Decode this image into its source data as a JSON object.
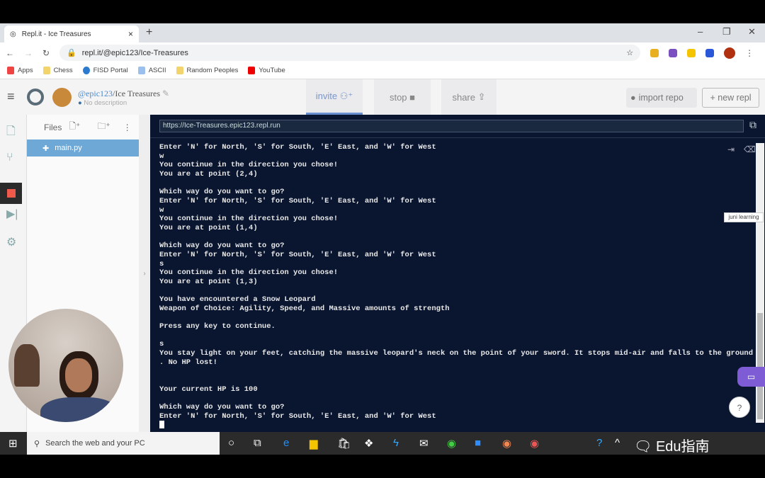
{
  "browser": {
    "tab_title": "Repl.it - Ice Treasures",
    "url": "repl.it/@epic123/Ice-Treasures",
    "bookmarks": [
      "Apps",
      "Chess",
      "FISD Portal",
      "ASCII",
      "Random Peoples",
      "YouTube"
    ]
  },
  "repl": {
    "user": "@epic123",
    "name": "/Ice Treasures",
    "description": "No description",
    "invite": "invite",
    "stop": "stop",
    "share": "share",
    "import_repo": "import repo",
    "new_repl": "+ new repl",
    "files_label": "Files",
    "file": "main.py",
    "run_url": "https://Ice-Treasures.epic123.repl.run"
  },
  "console": {
    "lines": [
      "Enter 'N' for North, 'S' for South, 'E' East, and 'W' for West",
      "w",
      "You continue in the direction you chose!",
      "You are at point (2,4)",
      "",
      "Which way do you want to go?",
      "Enter 'N' for North, 'S' for South, 'E' East, and 'W' for West",
      "w",
      "You continue in the direction you chose!",
      "You are at point (1,4)",
      "",
      "Which way do you want to go?",
      "Enter 'N' for North, 'S' for South, 'E' East, and 'W' for West",
      "s",
      "You continue in the direction you chose!",
      "You are at point (1,3)",
      "",
      "You have encountered a Snow Leopard",
      "Weapon of Choice: Agility, Speed, and Massive amounts of strength",
      "",
      "Press any key to continue.",
      "",
      "s",
      "You stay light on your feet, catching the massive leopard's neck on the point of your sword. It stops mid-air and falls to the ground",
      ". No HP lost!",
      "",
      "",
      "Your current HP is 100",
      "",
      "Which way do you want to go?",
      "Enter 'N' for North, 'S' for South, 'E' East, and 'W' for West"
    ]
  },
  "overlay": {
    "juni": "juni learning",
    "watermark": "Edu指南"
  },
  "taskbar": {
    "search_placeholder": "Search the web and your PC"
  }
}
